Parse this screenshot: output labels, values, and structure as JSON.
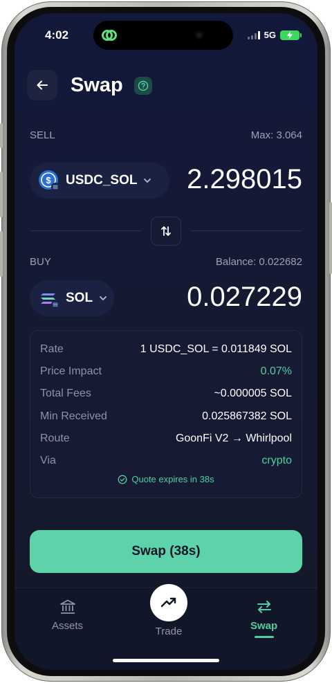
{
  "status_bar": {
    "time": "4:02",
    "network": "5G",
    "battery_state": "charging",
    "signal_bars_active": 1,
    "accent_color": "#3dd65f"
  },
  "header": {
    "title": "Swap",
    "back_icon": "arrow-left-icon",
    "help_icon": "help-circle-icon"
  },
  "sell": {
    "label": "SELL",
    "max_text": "Max: 3.064",
    "token": "USDC_SOL",
    "amount": "2.298015",
    "token_icon": "usdc-coin-icon"
  },
  "switch": {
    "icon": "swap-vertical-icon"
  },
  "buy": {
    "label": "BUY",
    "balance_text": "Balance: 0.022682",
    "token": "SOL",
    "amount": "0.027229",
    "token_icon": "solana-logo-icon"
  },
  "details": {
    "rows": [
      {
        "label": "Rate",
        "value": "1 USDC_SOL = 0.011849 SOL"
      },
      {
        "label": "Price Impact",
        "value": "0.07%"
      },
      {
        "label": "Total Fees",
        "value": "~0.000005 SOL"
      },
      {
        "label": "Min Received",
        "value": "0.025867382 SOL"
      },
      {
        "label": "Route",
        "value": "GoonFi V2 → Whirlpool"
      },
      {
        "label": "Via",
        "value": "crypto"
      }
    ],
    "quote_expires": "Quote expires in 38s"
  },
  "swap_button": {
    "label": "Swap (38s)",
    "color": "#5cd3aa"
  },
  "bottom_nav": {
    "items": [
      {
        "label": "Assets",
        "icon": "bank-icon"
      },
      {
        "label": "Trade",
        "icon": "trending-up-icon"
      },
      {
        "label": "Swap",
        "icon": "swap-horizontal-icon",
        "active": true
      }
    ],
    "active_color": "#4ecfa0"
  }
}
